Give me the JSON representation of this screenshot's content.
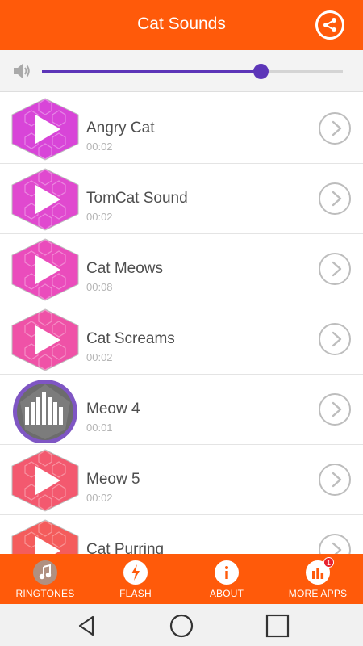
{
  "app": {
    "title": "Cat Sounds",
    "accent": "#ff5a0a",
    "slider_color": "#5c35b8"
  },
  "header": {
    "share_icon": "share-icon"
  },
  "volume": {
    "icon": "speaker-icon",
    "level": 0.73
  },
  "sounds": [
    {
      "name": "Angry Cat",
      "duration": "00:02",
      "color": "#d845d8",
      "playing": false
    },
    {
      "name": "TomCat Sound",
      "duration": "00:02",
      "color": "#e049cf",
      "playing": false
    },
    {
      "name": "Cat Meows",
      "duration": "00:08",
      "color": "#ea4cbc",
      "playing": false
    },
    {
      "name": "Cat Screams",
      "duration": "00:02",
      "color": "#ef52a7",
      "playing": false
    },
    {
      "name": "Meow 4",
      "duration": "00:01",
      "color": "#7f56c4",
      "playing": true
    },
    {
      "name": "Meow 5",
      "duration": "00:02",
      "color": "#f3596f",
      "playing": false
    },
    {
      "name": "Cat Purring",
      "duration": "",
      "color": "#f45c5c",
      "playing": false
    }
  ],
  "bottom_nav": [
    {
      "label": "RINGTONES",
      "icon": "music-note-icon"
    },
    {
      "label": "FLASH",
      "icon": "flash-icon"
    },
    {
      "label": "ABOUT",
      "icon": "info-icon"
    },
    {
      "label": "MORE APPS",
      "icon": "more-apps-icon",
      "badge": "1"
    }
  ],
  "system_nav": [
    "back-icon",
    "home-icon",
    "recents-icon"
  ]
}
